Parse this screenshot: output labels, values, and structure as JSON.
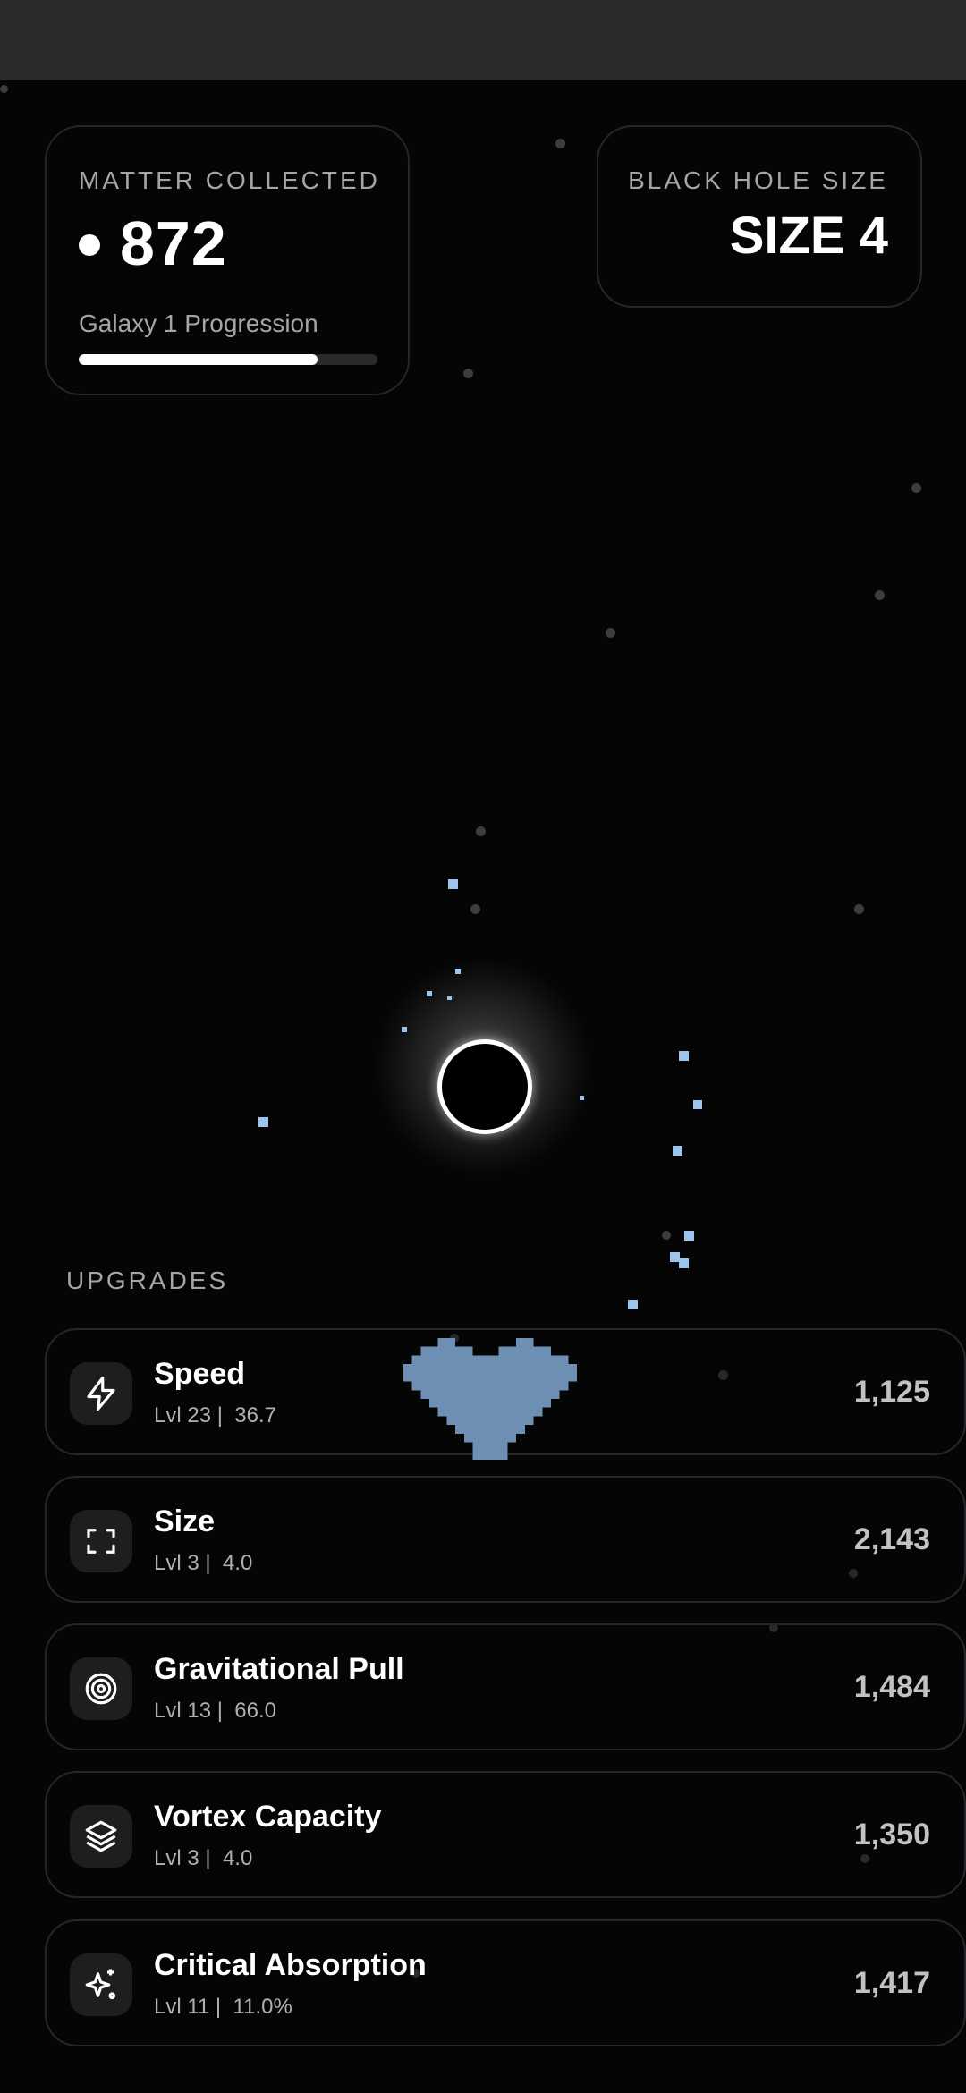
{
  "hud": {
    "matter": {
      "label": "MATTER COLLECTED",
      "value": "872",
      "progress_label": "Galaxy 1 Progression",
      "progress": 0.8
    },
    "black_hole": {
      "label": "BLACK HOLE SIZE",
      "value": "SIZE 4"
    }
  },
  "upgrades": {
    "title": "UPGRADES",
    "items": [
      {
        "name": "Speed",
        "level": "Lvl 23 |",
        "value": "36.7",
        "cost": "1,125",
        "icon": "lightning-icon"
      },
      {
        "name": "Size",
        "level": "Lvl 3 |",
        "value": "4.0",
        "cost": "2,143",
        "icon": "expand-frame-icon"
      },
      {
        "name": "Gravitational Pull",
        "level": "Lvl 13 |",
        "value": "66.0",
        "cost": "1,484",
        "icon": "target-icon"
      },
      {
        "name": "Vortex Capacity",
        "level": "Lvl 3 |",
        "value": "4.0",
        "cost": "1,350",
        "icon": "layers-icon"
      },
      {
        "name": "Critical Absorption",
        "level": "Lvl 11 |",
        "value": "11.0%",
        "cost": "1,417",
        "icon": "sparkles-icon"
      }
    ]
  },
  "colors": {
    "particle": "#9cc4ef",
    "heart": "#6e8fb4",
    "background": "#050505"
  }
}
